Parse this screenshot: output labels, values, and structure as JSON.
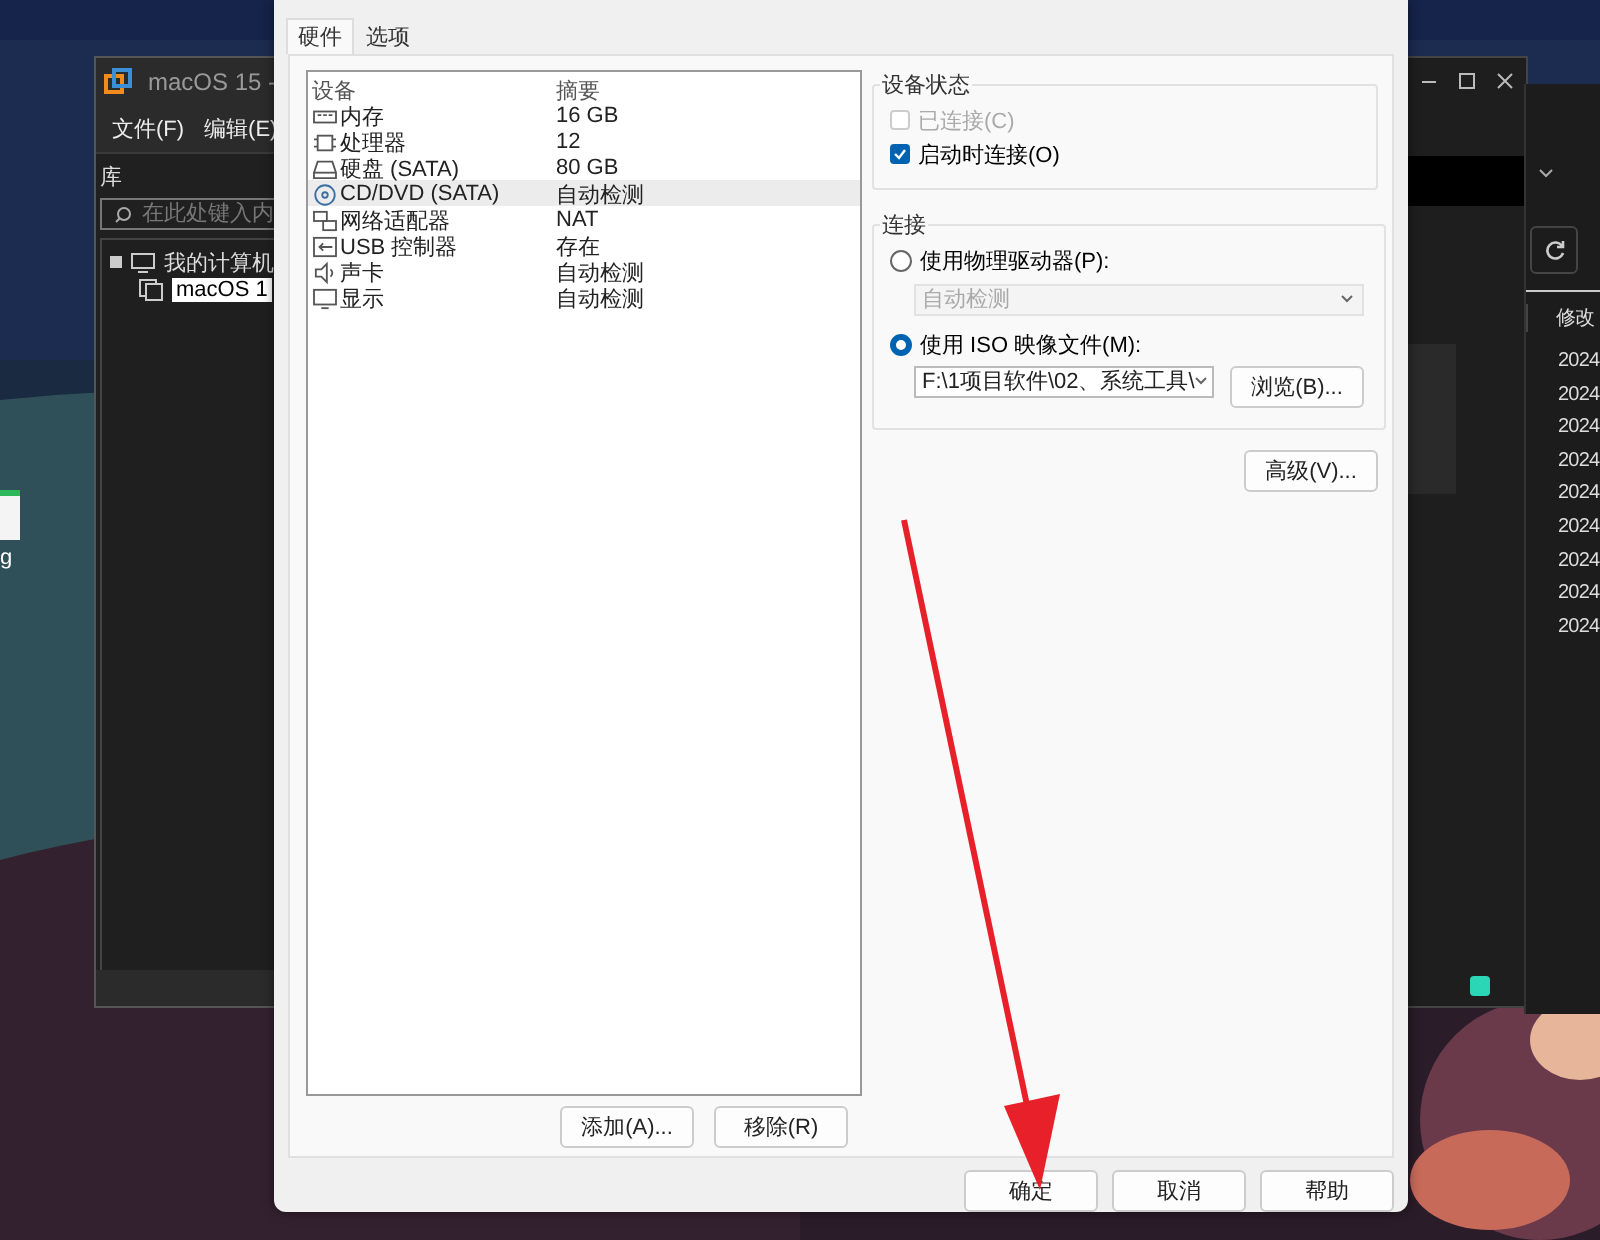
{
  "desktop": {
    "icon_label": "g"
  },
  "vm_window": {
    "title": "macOS 15 -",
    "menu": [
      "文件(F)",
      "编辑(E)"
    ],
    "library_label": "库",
    "search": {
      "placeholder": "在此处键入内"
    },
    "tree": [
      {
        "label": "我的计算机",
        "expanded": true,
        "children": [
          {
            "label": "macOS 1",
            "selected": true
          }
        ]
      }
    ]
  },
  "explorer": {
    "column": "修改",
    "rows": [
      "2024",
      "2024",
      "2024",
      "2024",
      "2024",
      "2024",
      "2024",
      "2024",
      "2024"
    ]
  },
  "dialog": {
    "tabs": [
      {
        "label": "硬件",
        "selected": true
      },
      {
        "label": "选项",
        "selected": false
      }
    ],
    "devices": {
      "columns": [
        "设备",
        "摘要"
      ],
      "rows": [
        {
          "kind": "memory",
          "name": "内存",
          "summary": "16 GB",
          "selected": false
        },
        {
          "kind": "cpu",
          "name": "处理器",
          "summary": "12",
          "selected": false
        },
        {
          "kind": "disk",
          "name": "硬盘 (SATA)",
          "summary": "80 GB",
          "selected": false
        },
        {
          "kind": "cd",
          "name": "CD/DVD (SATA)",
          "summary": "自动检测",
          "selected": true
        },
        {
          "kind": "network",
          "name": "网络适配器",
          "summary": "NAT",
          "selected": false
        },
        {
          "kind": "usb",
          "name": "USB 控制器",
          "summary": "存在",
          "selected": false
        },
        {
          "kind": "sound",
          "name": "声卡",
          "summary": "自动检测",
          "selected": false
        },
        {
          "kind": "display",
          "name": "显示",
          "summary": "自动检测",
          "selected": false
        }
      ]
    },
    "device_buttons": [
      "添加(A)...",
      "移除(R)"
    ],
    "device_status": {
      "title": "设备状态",
      "options": [
        {
          "label": "已连接(C)",
          "checked": false,
          "disabled": true
        },
        {
          "label": "启动时连接(O)",
          "checked": true,
          "disabled": false
        }
      ]
    },
    "connection": {
      "title": "连接",
      "sources": [
        {
          "label": "使用物理驱动器(P):",
          "selected": false,
          "value": "自动检测"
        },
        {
          "label": "使用 ISO 映像文件(M):",
          "selected": true,
          "value": "F:\\1项目软件\\02、系统工具\\",
          "button": "浏览(B)..."
        }
      ],
      "advanced": "高级(V)..."
    },
    "buttons": [
      "确定",
      "取消",
      "帮助"
    ]
  }
}
